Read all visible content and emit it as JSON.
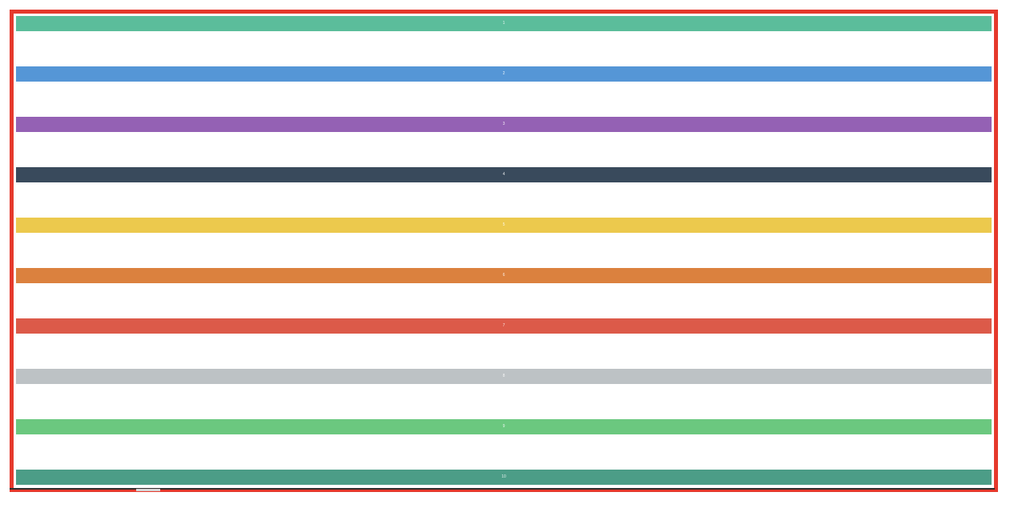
{
  "bars": [
    {
      "label": "1",
      "color": "#5bbd9b"
    },
    {
      "label": "2",
      "color": "#5596d6"
    },
    {
      "label": "3",
      "color": "#9461b4"
    },
    {
      "label": "4",
      "color": "#394a5c"
    },
    {
      "label": "5",
      "color": "#ecc94d"
    },
    {
      "label": "6",
      "color": "#db813e"
    },
    {
      "label": "7",
      "color": "#dc5a49"
    },
    {
      "label": "8",
      "color": "#bdc2c5"
    },
    {
      "label": "9",
      "color": "#6bc87f"
    },
    {
      "label": "10",
      "color": "#4c9d87"
    }
  ],
  "frame": {
    "border_color": "#e5392c"
  }
}
